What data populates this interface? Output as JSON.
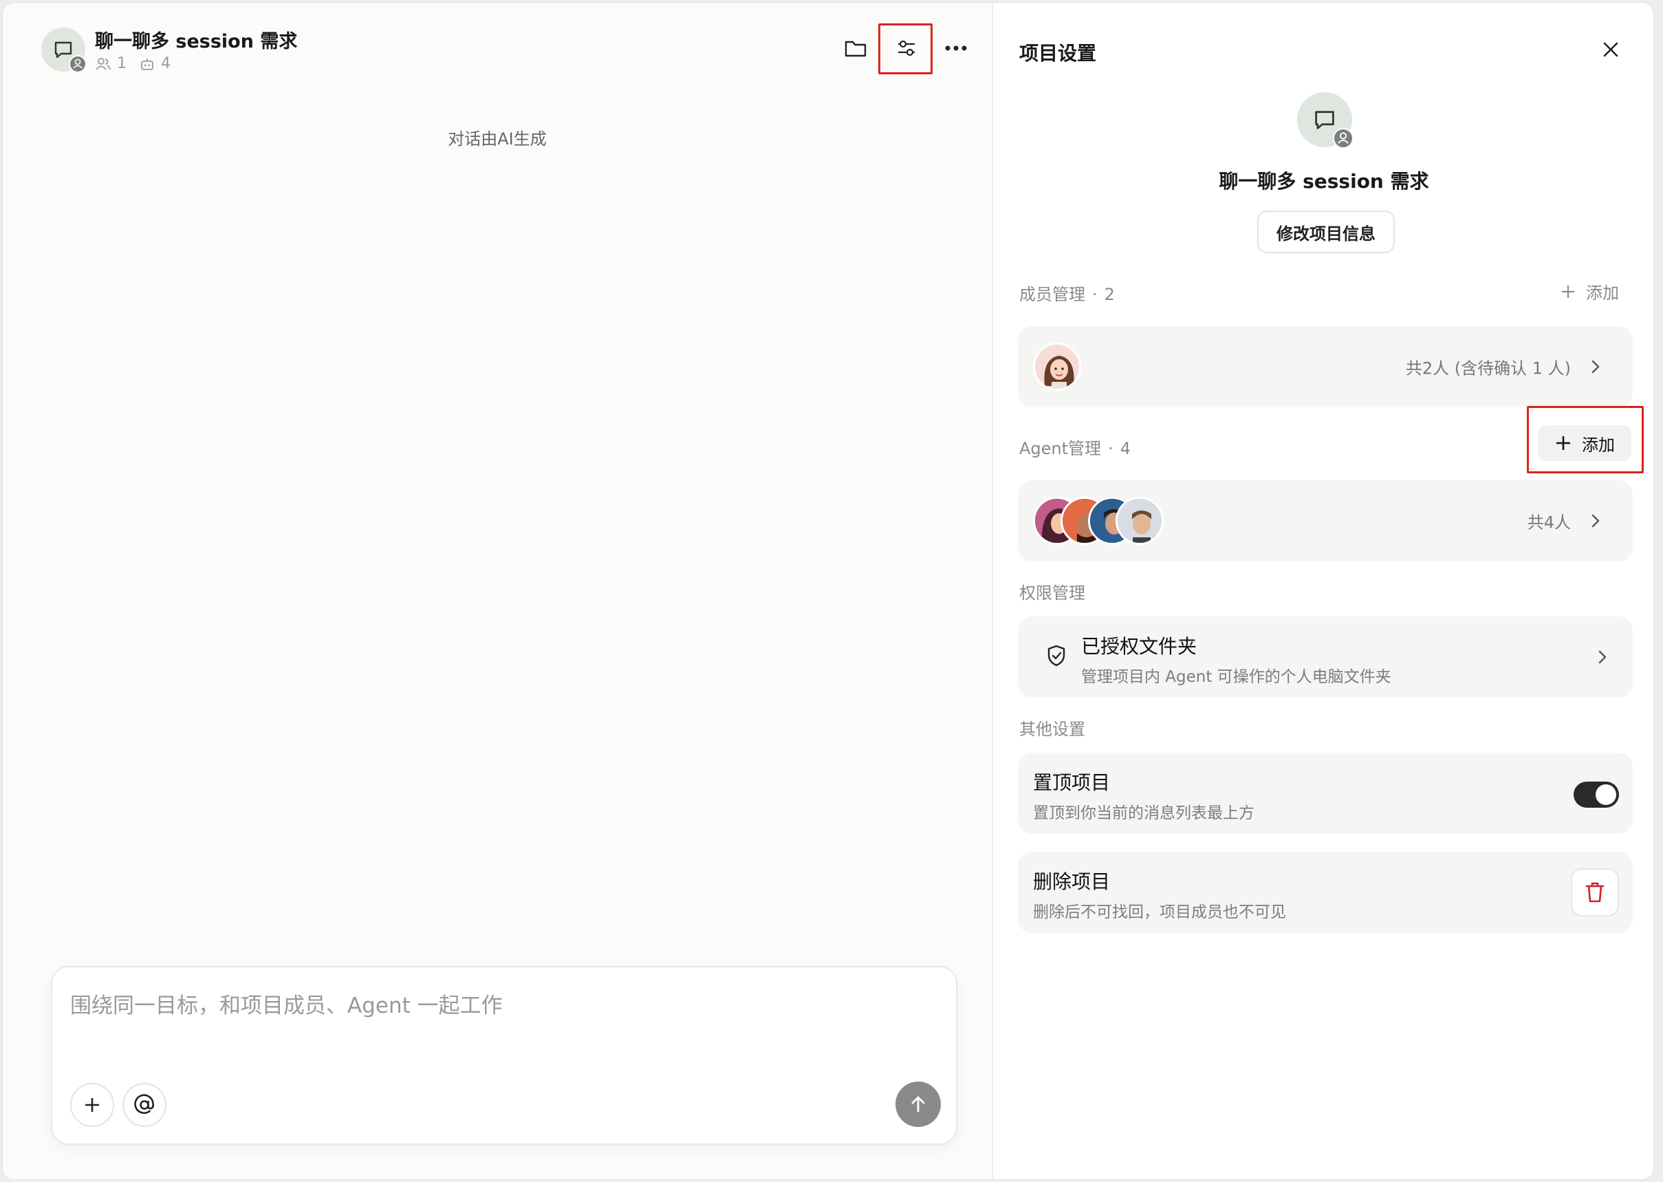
{
  "chat": {
    "project_title": "聊一聊多 session 需求",
    "member_count": "1",
    "agent_count": "4",
    "ai_note": "对话由AI生成",
    "composer_placeholder": "围绕同一目标，和项目成员、Agent 一起工作"
  },
  "settings": {
    "title": "项目设置",
    "project_name": "聊一聊多 session 需求",
    "edit_label": "修改项目信息",
    "members": {
      "label": "成员管理",
      "count": "2",
      "add_label": "添加",
      "summary": "共2人 (含待确认 1 人)"
    },
    "agents": {
      "label": "Agent管理",
      "count": "4",
      "add_label": "添加",
      "summary": "共4人"
    },
    "permissions": {
      "label": "权限管理",
      "folder_title": "已授权文件夹",
      "folder_desc": "管理项目内 Agent 可操作的个人电脑文件夹"
    },
    "other": {
      "label": "其他设置",
      "pin_title": "置顶项目",
      "pin_desc": "置顶到你当前的消息列表最上方",
      "pin_enabled": true,
      "delete_title": "删除项目",
      "delete_desc": "删除后不可找回，项目成员也不可见"
    }
  },
  "colors": {
    "highlight": "#e0201c",
    "delete": "#d42020",
    "toggle_on": "#2a2a2a"
  }
}
